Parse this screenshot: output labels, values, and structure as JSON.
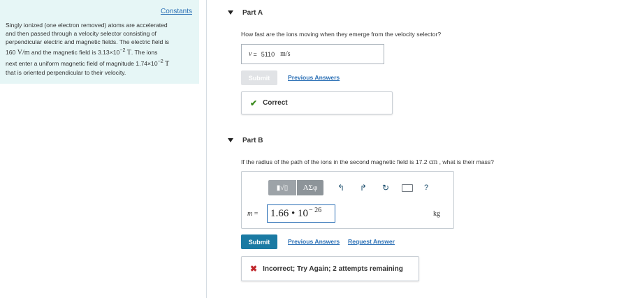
{
  "left": {
    "constants_link": "Constants",
    "problem_lines": [
      "Singly ionized (one electron removed) atoms are accelerated",
      "and then passed through a velocity selector consisting of",
      "perpendicular electric and magnetic fields. The electric field is"
    ],
    "line4_a": "160 ",
    "line4_unit": "V/m",
    "line4_b": " and the magnetic field is 3.13×10",
    "line4_exp": "−2",
    "line4_unit2": " T",
    "line4_c": ". The ions",
    "line5_a": "next enter a uniform magnetic field of magnitude 1.74×10",
    "line5_exp": "−2",
    "line5_unit": " T",
    "line6": "that is oriented perpendicular to their velocity."
  },
  "partA": {
    "title": "Part A",
    "question": "How fast are the ions moving when they emerge from the velocity selector?",
    "var": "v",
    "eq": " = ",
    "value": "5110",
    "unit": "m/s",
    "submit_label": "Submit",
    "previous_answers_label": "Previous Answers",
    "feedback_icon": "check-icon",
    "feedback_text": "Correct"
  },
  "partB": {
    "title": "Part B",
    "question_a": "If the radius of the path of the ions in the second magnetic field is 17.2 ",
    "question_unit": "cm",
    "question_b": " , what is their mass?",
    "toolbar": {
      "math_label": "▮√▯",
      "greek_label": "ΑΣφ",
      "help_label": "?"
    },
    "var": "m",
    "eq": " = ",
    "mantissa": "1.66 • 10",
    "exponent": "− 26",
    "unit": "kg",
    "submit_label": "Submit",
    "previous_answers_label": "Previous Answers",
    "request_answer_label": "Request Answer",
    "feedback_icon": "x-icon",
    "feedback_text": "Incorrect; Try Again; 2 attempts remaining"
  },
  "colors": {
    "left_bg": "#e6f6f6",
    "link": "#2a6fb5",
    "primary_button": "#1a7aa3",
    "correct": "#3a8a1d",
    "incorrect": "#c0262b"
  }
}
